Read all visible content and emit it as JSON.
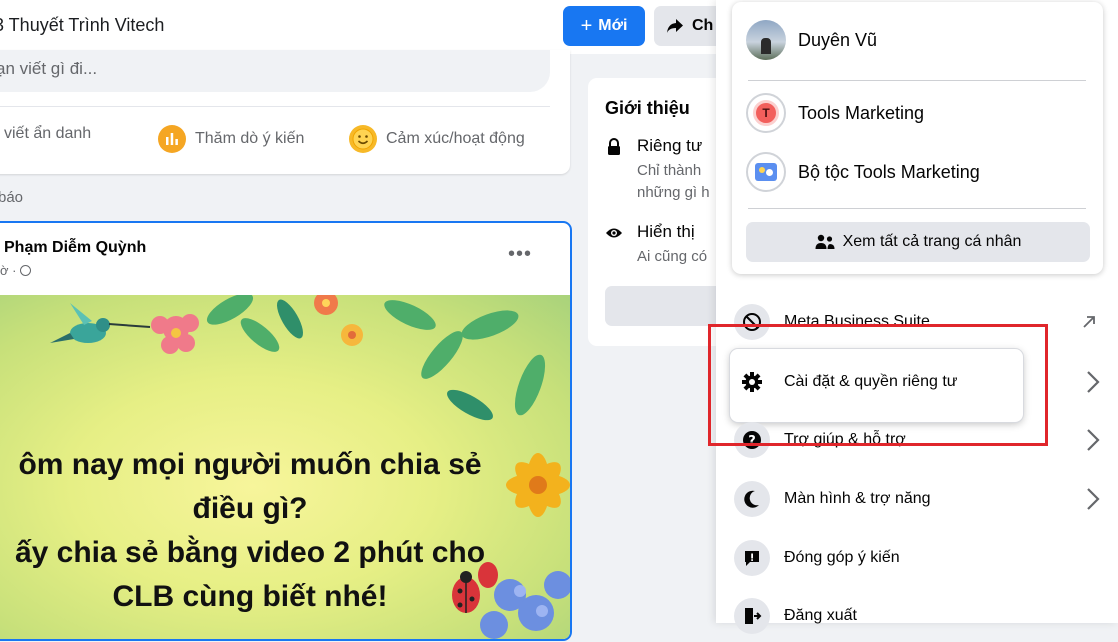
{
  "header": {
    "group_title": "3 Thuyết Trình Vitech",
    "new_button": "Mới",
    "new_icon": "plus-icon",
    "share_button": "Ch",
    "share_icon": "share-arrow-icon"
  },
  "composer": {
    "placeholder": "ạn viết gì đi...",
    "actions": [
      {
        "label": "i viết ẩn danh",
        "icon": "anonymous-icon"
      },
      {
        "label": "Thăm dò ý kiến",
        "icon": "poll-icon",
        "color": "#f5a623"
      },
      {
        "label": "Cảm xúc/hoạt động",
        "icon": "smiley-icon",
        "color": "#f7b928"
      }
    ]
  },
  "feed": {
    "section_label": "báo",
    "post": {
      "author": "Phạm Diễm Quỳnh",
      "meta": "ờ ·",
      "more": "•••",
      "image_text": [
        "ôm nay mọi người muốn chia sẻ",
        "điều gì?",
        "ấy chia sẻ bằng video 2 phút cho",
        "CLB cùng biết nhé!"
      ]
    }
  },
  "intro": {
    "title": "Giới thiệu",
    "privacy_title": "Riêng tư",
    "privacy_desc_1": "Chỉ thành",
    "privacy_desc_2": "những gì h",
    "visible_title": "Hiển thị",
    "visible_desc": "Ai cũng có"
  },
  "account_menu": {
    "profiles": [
      {
        "name": "Duyên Vũ",
        "icon": "user-avatar"
      },
      {
        "name": "Tools Marketing",
        "icon": "page-avatar-t"
      },
      {
        "name": "Bộ tộc Tools Marketing",
        "icon": "group-avatar"
      }
    ],
    "see_all": "Xem tất cả trang cá nhân",
    "see_all_icon": "people-icon",
    "items": [
      {
        "label": "Meta Business Suite",
        "icon": "meta-business-icon",
        "trailing": "external-arrow-icon"
      },
      {
        "label": "Cài đặt & quyền riêng tư",
        "icon": "gear-icon",
        "trailing": "chevron-right-icon"
      },
      {
        "label": "Trợ giúp & hỗ trợ",
        "icon": "help-icon",
        "trailing": "chevron-right-icon"
      },
      {
        "label": "Màn hình & trợ năng",
        "icon": "moon-icon",
        "trailing": "chevron-right-icon"
      },
      {
        "label": "Đóng góp ý kiến",
        "icon": "feedback-icon",
        "trailing": ""
      },
      {
        "label": "Đăng xuất",
        "icon": "logout-icon",
        "trailing": ""
      }
    ],
    "highlight_color": "#e0262b"
  }
}
